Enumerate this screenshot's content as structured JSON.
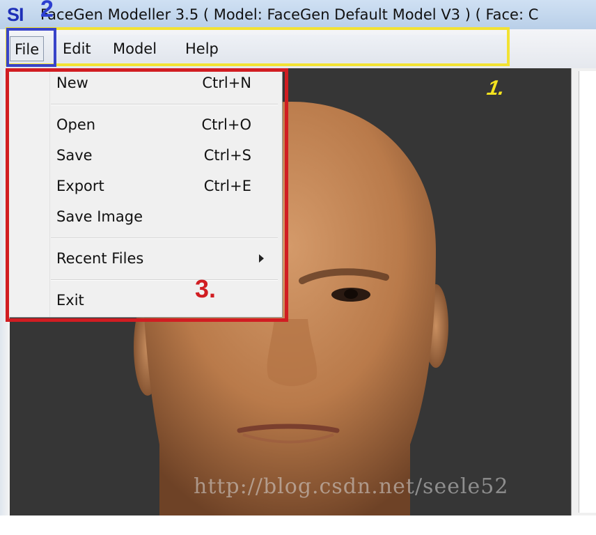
{
  "window": {
    "title": "FaceGen Modeller 3.5 ( Model: FaceGen Default Model V3 ) ( Face: C",
    "app_icon_text": "SI"
  },
  "menubar": {
    "items": [
      "File",
      "Edit",
      "Model",
      "Help"
    ],
    "active": "File"
  },
  "file_menu": {
    "items": [
      {
        "label": "New",
        "shortcut": "Ctrl+N"
      },
      {
        "label": "Open",
        "shortcut": "Ctrl+O"
      },
      {
        "label": "Save",
        "shortcut": "Ctrl+S"
      },
      {
        "label": "Export",
        "shortcut": "Ctrl+E"
      },
      {
        "label": "Save Image",
        "shortcut": ""
      },
      {
        "label": "Recent Files",
        "shortcut": "",
        "submenu": true
      },
      {
        "label": "Exit",
        "shortcut": ""
      }
    ]
  },
  "annotations": {
    "one": "1.",
    "two": "2",
    "three": "3."
  },
  "watermark": "http://blog.csdn.net/seele52",
  "colors": {
    "highlight_menubar": "#f2e233",
    "highlight_file": "#3843c9",
    "highlight_dropdown": "#d11d22",
    "viewport_bg": "#363636"
  }
}
